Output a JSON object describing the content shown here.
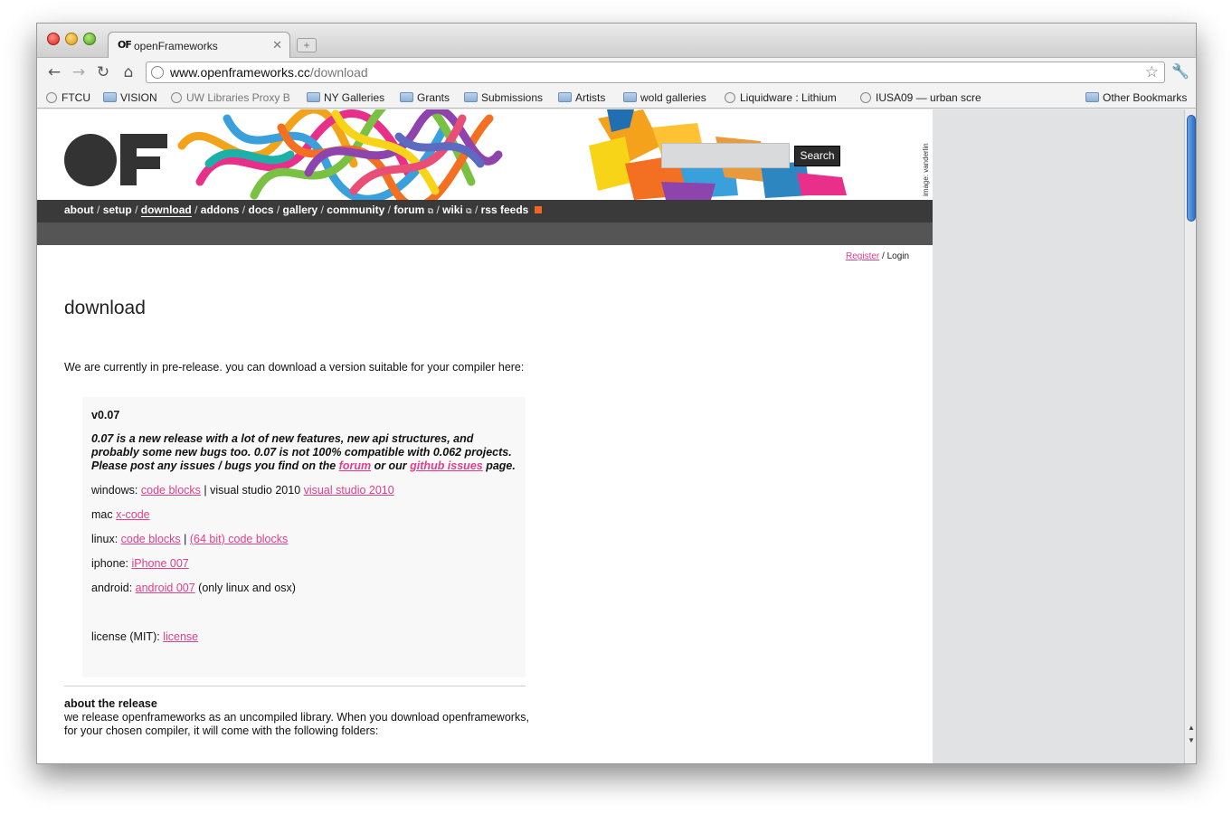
{
  "browser": {
    "tab_title": "openFrameworks",
    "tab_favicon": "OF",
    "tab_close": "✕",
    "new_tab": "+",
    "url_host": "www.openframeworks.cc",
    "url_path": "/download",
    "nav_back": "←",
    "nav_forward": "→",
    "nav_reload": "↻",
    "nav_home": "⌂",
    "star": "☆",
    "wrench": "🔧",
    "bookmarks": [
      {
        "label": "FTCU",
        "icon": "globe"
      },
      {
        "label": "VISION",
        "icon": "folder"
      },
      {
        "label": "UW Libraries Proxy B",
        "icon": "globe"
      },
      {
        "label": "NY Galleries",
        "icon": "folder"
      },
      {
        "label": "Grants",
        "icon": "folder"
      },
      {
        "label": "Submissions",
        "icon": "folder"
      },
      {
        "label": "Artists",
        "icon": "folder"
      },
      {
        "label": "wold galleries",
        "icon": "folder"
      },
      {
        "label": "Liquidware : Lithium",
        "icon": "globe"
      },
      {
        "label": "IUSA09 — urban scre",
        "icon": "globe"
      },
      {
        "label": "Other Bookmarks",
        "icon": "folder"
      }
    ]
  },
  "site": {
    "search_button": "Search",
    "search_value": "",
    "image_credit": "image: vanderlin",
    "nav": {
      "about": "about",
      "setup": "setup",
      "download": "download",
      "addons": "addons",
      "docs": "docs",
      "gallery": "gallery",
      "community": "community",
      "forum": "forum",
      "wiki": "wiki",
      "rss": "rss feeds",
      "sep": "/",
      "ext": "⧉"
    },
    "auth": {
      "register": "Register",
      "sep": "/",
      "login": "Login"
    }
  },
  "content": {
    "title": "download",
    "intro": "We are currently in pre-release. you can download a version suitable for your compiler here:",
    "version": "v0.07",
    "desc_part1": "0.07 is a new release with a lot of new features, new api structures, and probably some new bugs too. 0.07 is not 100% compatible with 0.062 projects. Please post any issues / bugs you find on the ",
    "desc_forum": "forum",
    "desc_part2": " or our ",
    "desc_github": "github issues",
    "desc_part3": " page.",
    "windows_label": "windows: ",
    "windows_link1": "code blocks",
    "windows_mid": " | visual studio 2010 ",
    "windows_link2": "visual studio 2010",
    "mac_label": "mac ",
    "mac_link": "x-code",
    "linux_label": "linux: ",
    "linux_link1": "code blocks",
    "linux_mid": " | ",
    "linux_link2": "(64 bit) code blocks",
    "iphone_label": "iphone: ",
    "iphone_link": "iPhone 007",
    "android_label": "android: ",
    "android_link": "android 007",
    "android_note": " (only linux and osx)",
    "license_label": "license (MIT): ",
    "license_link": "license",
    "about_title": "about the release",
    "about_text": "we release openframeworks as an uncompiled library. When you download openframeworks, for your chosen compiler, it will come with the following folders:"
  },
  "colors": {
    "link": "#e0408a",
    "navbar": "#3a3a3a",
    "navbar2": "#555555"
  }
}
